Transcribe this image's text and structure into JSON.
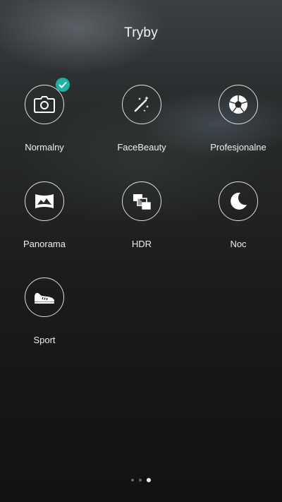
{
  "header": {
    "title": "Tryby"
  },
  "modes": [
    {
      "label": "Normalny",
      "icon": "camera-icon",
      "selected": true
    },
    {
      "label": "FaceBeauty",
      "icon": "magic-wand-icon",
      "selected": false
    },
    {
      "label": "Profesjonalne",
      "icon": "aperture-icon",
      "selected": false
    },
    {
      "label": "Panorama",
      "icon": "panorama-icon",
      "selected": false
    },
    {
      "label": "HDR",
      "icon": "hdr-icon",
      "selected": false
    },
    {
      "label": "Noc",
      "icon": "moon-icon",
      "selected": false
    },
    {
      "label": "Sport",
      "icon": "sneaker-icon",
      "selected": false
    }
  ],
  "pager": {
    "pages": 3,
    "current": 3
  },
  "colors": {
    "accent": "#1fb3a8",
    "text": "#ffffff"
  }
}
